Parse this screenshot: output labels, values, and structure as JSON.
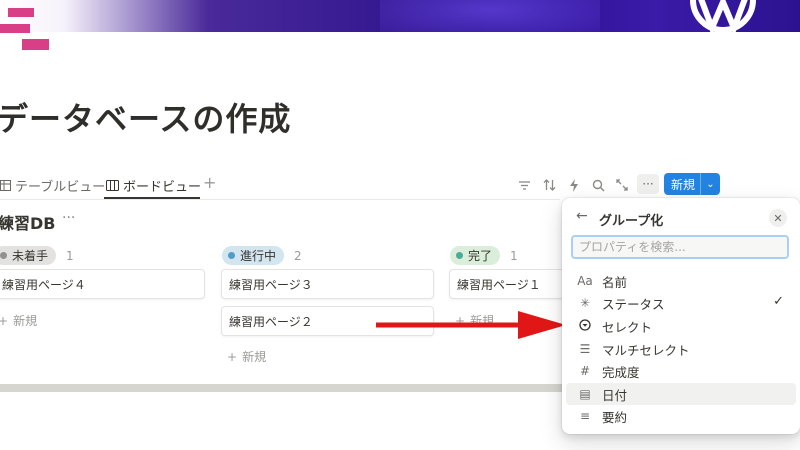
{
  "page": {
    "title": "データベースの作成"
  },
  "tabs": [
    {
      "label": "テーブルビュー",
      "icon": "table-icon"
    },
    {
      "label": "ボードビュー",
      "icon": "board-icon"
    }
  ],
  "toolbar": {
    "icons": [
      "filter-icon",
      "sort-icon",
      "lightning-icon",
      "search-icon",
      "expand-icon"
    ],
    "more_label": "···",
    "new_label": "新規"
  },
  "database": {
    "title": "練習DB",
    "more_label": "···"
  },
  "board": {
    "columns": [
      {
        "status": "未着手",
        "count": "1",
        "color": "#91918e",
        "bg": "#e3e2e0",
        "cards": [
          "練習用ページ４"
        ]
      },
      {
        "status": "進行中",
        "count": "2",
        "color": "#529cca",
        "bg": "#d3e5ef",
        "cards": [
          "練習用ページ３",
          "練習用ページ２"
        ]
      },
      {
        "status": "完了",
        "count": "1",
        "color": "#4dab9a",
        "bg": "#dbeddb",
        "cards": [
          "練習用ページ１"
        ]
      }
    ],
    "add_label": "新規"
  },
  "group_panel": {
    "title": "グループ化",
    "search_placeholder": "プロパティを検索...",
    "items": [
      {
        "icon": "Aa",
        "label": "名前"
      },
      {
        "icon": "✳",
        "label": "ステータス",
        "checked": true,
        "check": "✓"
      },
      {
        "icon": "▾",
        "label": "セレクト"
      },
      {
        "icon": "☰",
        "label": "マルチセレクト"
      },
      {
        "icon": "#",
        "label": "完成度"
      },
      {
        "icon": "▤",
        "label": "日付",
        "highlighted": true
      },
      {
        "icon": "≡",
        "label": "要約"
      }
    ]
  },
  "colors": {
    "accent": "#2383e2",
    "arrow": "#e11717",
    "deco": "#d83f87"
  }
}
